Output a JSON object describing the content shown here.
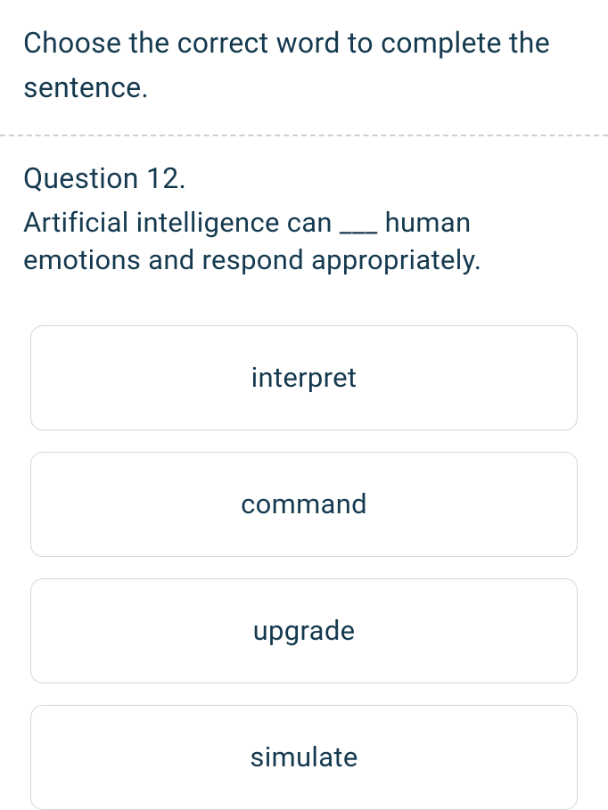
{
  "instruction": "Choose the correct word to complete the sentence.",
  "question": {
    "number": "Question 12.",
    "text": "Artificial intelligence can ___ human emotions and respond appropriately."
  },
  "options": [
    {
      "label": "interpret"
    },
    {
      "label": "command"
    },
    {
      "label": "upgrade"
    },
    {
      "label": "simulate"
    }
  ]
}
